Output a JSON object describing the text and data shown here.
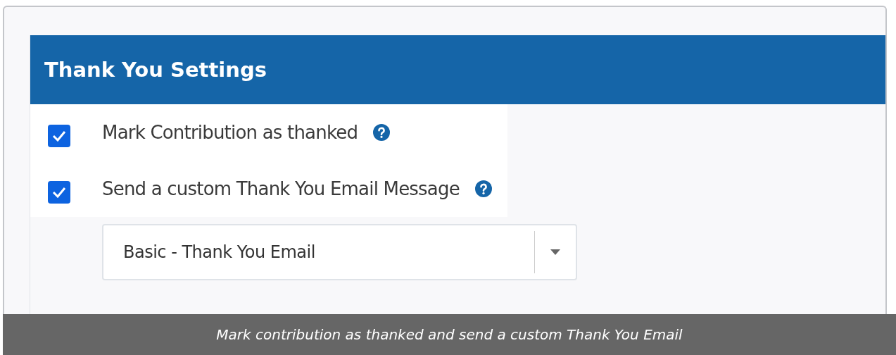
{
  "panel": {
    "title": "Thank You Settings"
  },
  "options": [
    {
      "label": "Mark Contribution as thanked",
      "checked": true
    },
    {
      "label": "Send a custom Thank You Email Message",
      "checked": true
    }
  ],
  "template_select": {
    "value": "Basic - Thank You Email"
  },
  "caption": "Mark contribution as thanked and send a custom Thank You Email"
}
